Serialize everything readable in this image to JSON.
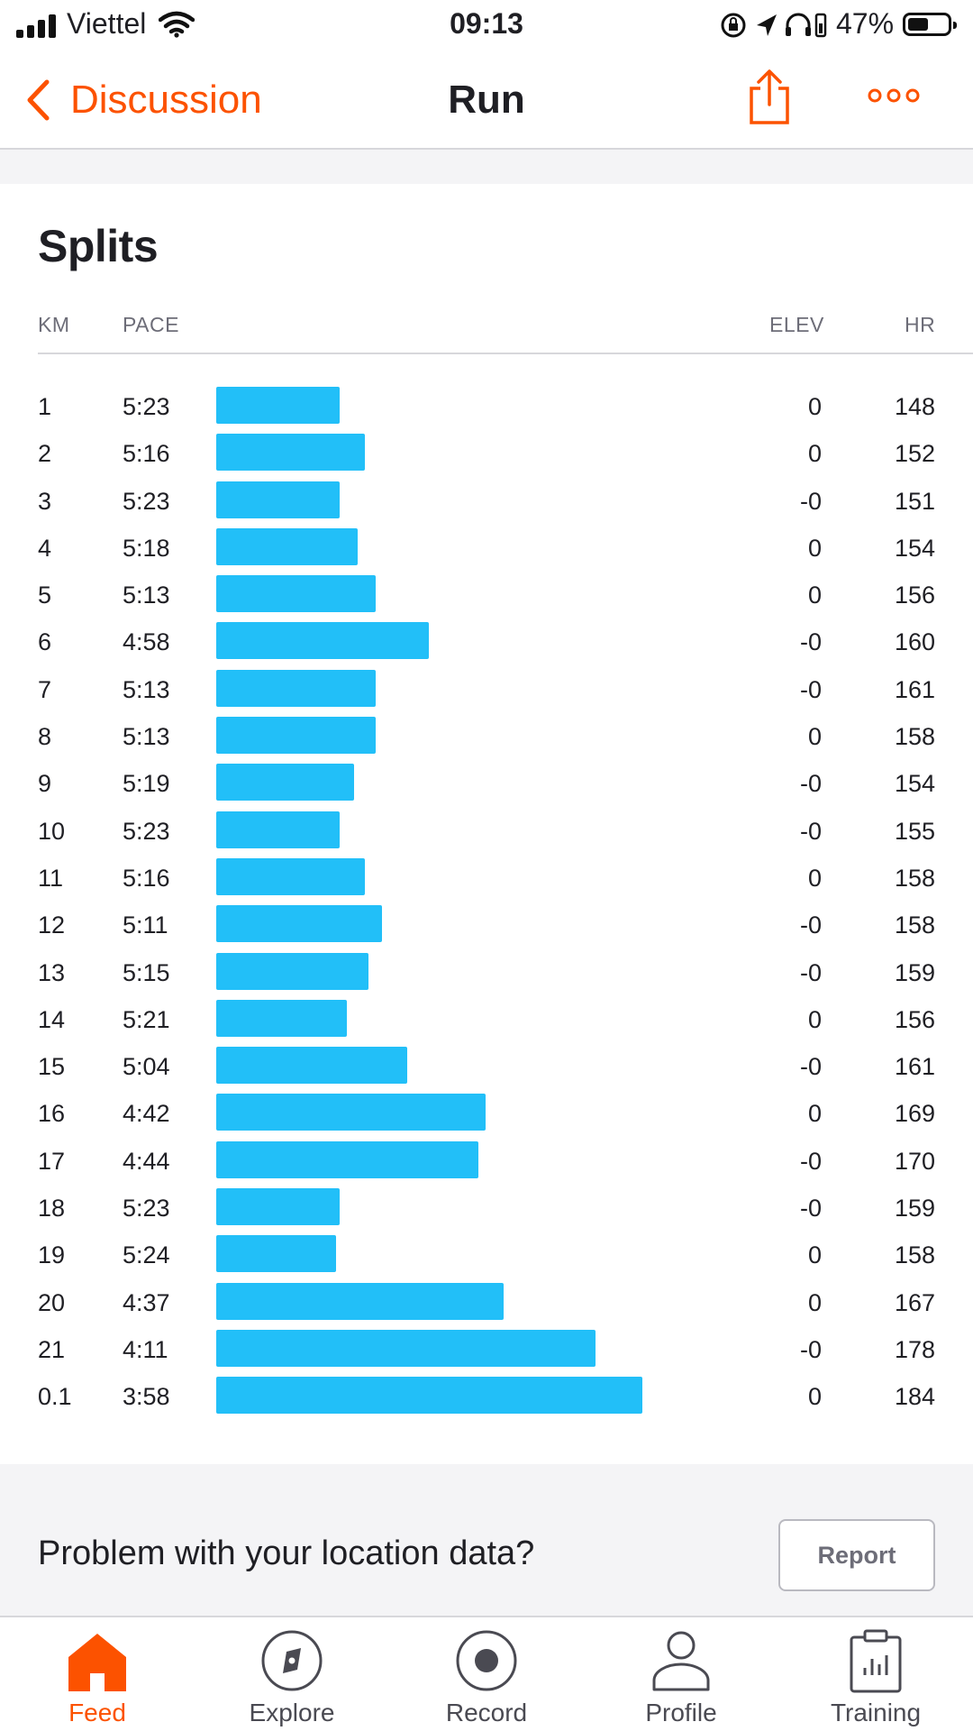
{
  "status_bar": {
    "carrier": "Viettel",
    "time": "09:13",
    "battery": "47%"
  },
  "nav": {
    "back_label": "Discussion",
    "title": "Run"
  },
  "splits": {
    "title": "Splits",
    "columns": {
      "km": "KM",
      "pace": "PACE",
      "elev": "ELEV",
      "hr": "HR"
    },
    "rows": [
      {
        "km": "1",
        "pace": "5:23",
        "elev": "0",
        "hr": "148"
      },
      {
        "km": "2",
        "pace": "5:16",
        "elev": "0",
        "hr": "152"
      },
      {
        "km": "3",
        "pace": "5:23",
        "elev": "-0",
        "hr": "151"
      },
      {
        "km": "4",
        "pace": "5:18",
        "elev": "0",
        "hr": "154"
      },
      {
        "km": "5",
        "pace": "5:13",
        "elev": "0",
        "hr": "156"
      },
      {
        "km": "6",
        "pace": "4:58",
        "elev": "-0",
        "hr": "160"
      },
      {
        "km": "7",
        "pace": "5:13",
        "elev": "-0",
        "hr": "161"
      },
      {
        "km": "8",
        "pace": "5:13",
        "elev": "0",
        "hr": "158"
      },
      {
        "km": "9",
        "pace": "5:19",
        "elev": "-0",
        "hr": "154"
      },
      {
        "km": "10",
        "pace": "5:23",
        "elev": "-0",
        "hr": "155"
      },
      {
        "km": "11",
        "pace": "5:16",
        "elev": "0",
        "hr": "158"
      },
      {
        "km": "12",
        "pace": "5:11",
        "elev": "-0",
        "hr": "158"
      },
      {
        "km": "13",
        "pace": "5:15",
        "elev": "-0",
        "hr": "159"
      },
      {
        "km": "14",
        "pace": "5:21",
        "elev": "0",
        "hr": "156"
      },
      {
        "km": "15",
        "pace": "5:04",
        "elev": "-0",
        "hr": "161"
      },
      {
        "km": "16",
        "pace": "4:42",
        "elev": "0",
        "hr": "169"
      },
      {
        "km": "17",
        "pace": "4:44",
        "elev": "-0",
        "hr": "170"
      },
      {
        "km": "18",
        "pace": "5:23",
        "elev": "-0",
        "hr": "159"
      },
      {
        "km": "19",
        "pace": "5:24",
        "elev": "0",
        "hr": "158"
      },
      {
        "km": "20",
        "pace": "4:37",
        "elev": "0",
        "hr": "167"
      },
      {
        "km": "21",
        "pace": "4:11",
        "elev": "-0",
        "hr": "178"
      },
      {
        "km": "0.1",
        "pace": "3:58",
        "elev": "0",
        "hr": "184"
      }
    ]
  },
  "problem": {
    "text": "Problem with your location data?",
    "button": "Report"
  },
  "tabs": [
    {
      "label": "Feed",
      "icon": "home-icon",
      "active": true
    },
    {
      "label": "Explore",
      "icon": "compass-icon",
      "active": false
    },
    {
      "label": "Record",
      "icon": "record-icon",
      "active": false
    },
    {
      "label": "Profile",
      "icon": "person-icon",
      "active": false
    },
    {
      "label": "Training",
      "icon": "clipboard-chart-icon",
      "active": false
    }
  ],
  "colors": {
    "accent": "#fc5200",
    "bar": "#22bff8",
    "text": "#1f1f24",
    "muted": "#6d6d78"
  }
}
